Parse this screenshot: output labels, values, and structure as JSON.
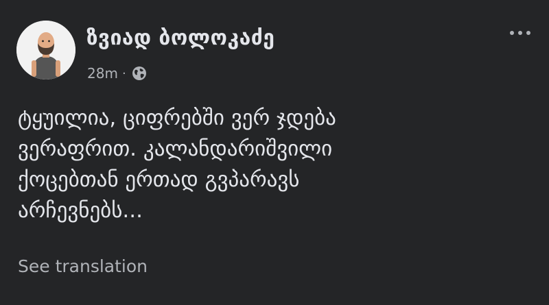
{
  "author": {
    "name": "ზვიად ბოლოკაძე"
  },
  "meta": {
    "time": "28m",
    "separator": "·",
    "privacy_icon": "globe-icon"
  },
  "post": {
    "text": "ტყუილია, ციფრებში ვერ ჯდება\nვერაფრით. კალანდარიშვილი\nქოცებთან ერთად გვპარავს\nარჩევნებს..."
  },
  "actions": {
    "see_translation": "See translation",
    "more_icon": "more-horizontal-icon"
  },
  "colors": {
    "background": "#242527",
    "text_primary": "#e4e6eb",
    "text_secondary": "#b0b3b8"
  }
}
